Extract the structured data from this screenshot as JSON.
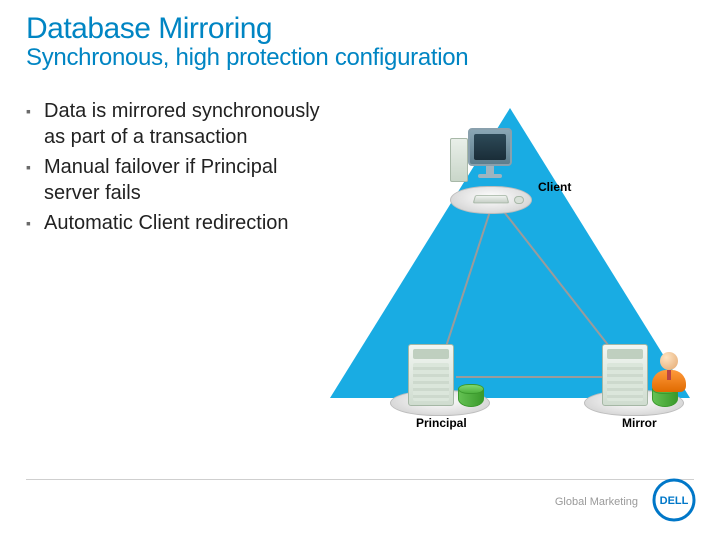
{
  "title": "Database Mirroring",
  "subtitle": "Synchronous, high protection configuration",
  "bullets": [
    "Data is mirrored synchronously as part of a transaction",
    "Manual failover if Principal server fails",
    "Automatic Client redirection"
  ],
  "diagram": {
    "client_label": "Client",
    "principal_label": "Principal",
    "mirror_label": "Mirror"
  },
  "footer": "Global Marketing",
  "brand": "DELL",
  "colors": {
    "accent": "#0085c3",
    "triangle": "#00a3e0"
  }
}
